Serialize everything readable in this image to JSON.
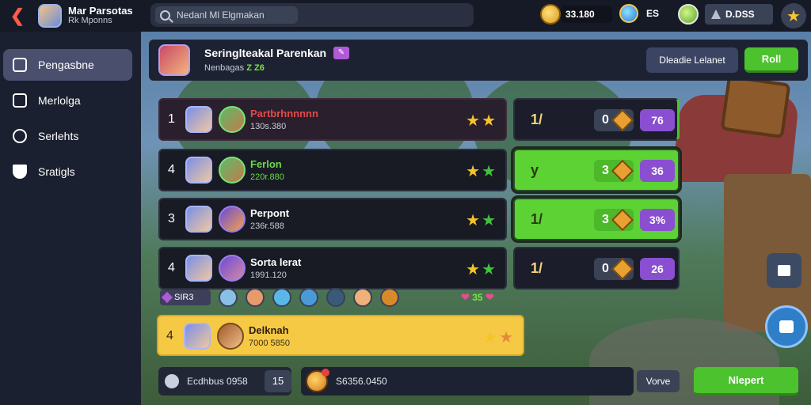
{
  "topbar": {
    "player_name": "Mar Parsotas",
    "player_sub": "Rk Mponns",
    "search_placeholder": "Nedanl Ml Elgmakan",
    "coins": "33.180",
    "gems": "ES",
    "energy": "D.DSS"
  },
  "sidebar": {
    "items": [
      {
        "label": "Pengasbne",
        "icon": "inbox-icon",
        "active": true
      },
      {
        "label": "Merlolga",
        "icon": "tablet-icon",
        "active": false
      },
      {
        "label": "Serlehts",
        "icon": "compass-icon",
        "active": false
      },
      {
        "label": "Sratigls",
        "icon": "shield-icon",
        "active": false
      }
    ]
  },
  "header": {
    "title": "Seringlteakal Parenkan",
    "subtitle": "Nenbagas",
    "subtitle_value": "Z Z6",
    "secondary_button": "Dleadie Lelanet",
    "primary_button": "Roll"
  },
  "rows": [
    {
      "rank": "1",
      "name": "Partbrhnnnnn",
      "score": "130s.380",
      "name_color": "#e44a4a",
      "score_color": "#c8ccd8",
      "stars": [
        "gold",
        "gold"
      ]
    },
    {
      "rank": "4",
      "name": "Ferlon",
      "score": "220r.880",
      "name_color": "#6fd84a",
      "score_color": "#6fd84a",
      "stars": [
        "gold",
        "green"
      ]
    },
    {
      "rank": "3",
      "name": "Perpont",
      "score": "236r.588",
      "name_color": "#ffffff",
      "score_color": "#c8ccd8",
      "stars": [
        "gold",
        "green"
      ]
    },
    {
      "rank": "4",
      "name": "Sorta lerat",
      "score": "1991.120",
      "name_color": "#ffffff",
      "score_color": "#c8ccd8",
      "stars": [
        "gold",
        "green"
      ]
    }
  ],
  "stats": [
    {
      "left": "1/",
      "mid": "0",
      "right": "76",
      "highlight": false
    },
    {
      "left": "y",
      "mid": "3",
      "right": "36",
      "highlight": true
    },
    {
      "left": "1/",
      "mid": "3",
      "right": "3%",
      "highlight": true
    },
    {
      "left": "1/",
      "mid": "0",
      "right": "26",
      "highlight": false
    }
  ],
  "team_strip": {
    "badge": "SIR3",
    "value": "35"
  },
  "my_row": {
    "rank": "4",
    "name": "Delknah",
    "score": "7000 5850",
    "stars": [
      "gold",
      "orange"
    ]
  },
  "bottom": {
    "left_text": "Ecdhbus 0958",
    "count": "15",
    "mid_text": "S6356.0450",
    "vorve_button": "Vorve",
    "next_button": "Nlepert"
  },
  "colors": {
    "accent_green": "#4cc22e",
    "accent_purple": "#8a4fd0",
    "highlight_yellow": "#f6c945",
    "back_red": "#ff5a4a"
  }
}
